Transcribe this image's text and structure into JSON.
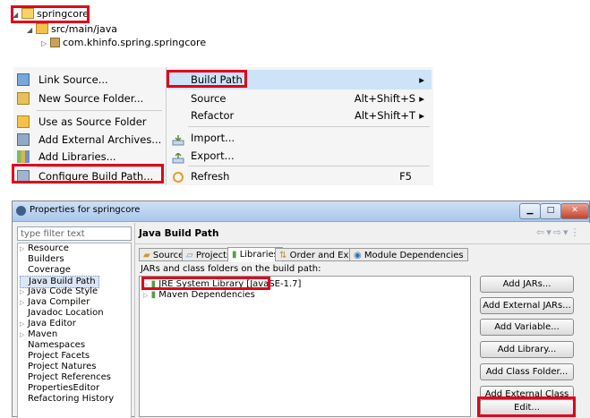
{
  "tree": {
    "project": "springcore",
    "folder": "src/main/java",
    "package": "com.khinfo.spring.springcore"
  },
  "menu": {
    "left_items": [
      {
        "label": "Link Source...",
        "icon": "link-source-icon"
      },
      {
        "label": "New Source Folder...",
        "icon": "new-source-folder-icon"
      },
      {
        "label": "Use as Source Folder",
        "icon": "source-folder-icon"
      },
      {
        "label": "Add External Archives...",
        "icon": "jar-icon"
      },
      {
        "label": "Add Libraries...",
        "icon": "library-icon"
      },
      {
        "label": "Configure Build Path...",
        "icon": "configure-build-path-icon"
      }
    ],
    "right_items": [
      {
        "label": "Build Path",
        "shortcut": "",
        "arrow": "▸"
      },
      {
        "label": "Source",
        "shortcut": "Alt+Shift+S",
        "arrow": "▸"
      },
      {
        "label": "Refactor",
        "shortcut": "Alt+Shift+T",
        "arrow": "▸"
      },
      {
        "label": "Import...",
        "shortcut": "",
        "arrow": ""
      },
      {
        "label": "Export...",
        "shortcut": "",
        "arrow": ""
      },
      {
        "label": "Refresh",
        "shortcut": "F5",
        "arrow": ""
      }
    ]
  },
  "dialog": {
    "title": "Properties for springcore",
    "filter_placeholder": "type filter text",
    "nav_items": [
      {
        "label": "Resource",
        "expandable": true
      },
      {
        "label": "Builders",
        "expandable": false
      },
      {
        "label": "Coverage",
        "expandable": false
      },
      {
        "label": "Java Build Path",
        "expandable": false,
        "selected": true
      },
      {
        "label": "Java Code Style",
        "expandable": true
      },
      {
        "label": "Java Compiler",
        "expandable": true
      },
      {
        "label": "Javadoc Location",
        "expandable": false
      },
      {
        "label": "Java Editor",
        "expandable": true
      },
      {
        "label": "Maven",
        "expandable": true
      },
      {
        "label": "Namespaces",
        "expandable": false
      },
      {
        "label": "Project Facets",
        "expandable": false
      },
      {
        "label": "Project Natures",
        "expandable": false
      },
      {
        "label": "Project References",
        "expandable": false
      },
      {
        "label": "PropertiesEditor",
        "expandable": false
      },
      {
        "label": "Refactoring History",
        "expandable": false
      }
    ],
    "page_title": "Java Build Path",
    "tabs": [
      {
        "label": "Source",
        "icon": "source-tab-icon"
      },
      {
        "label": "Projects",
        "icon": "projects-tab-icon"
      },
      {
        "label": "Libraries",
        "icon": "libraries-tab-icon",
        "active": true
      },
      {
        "label": "Order and Export",
        "icon": "order-export-tab-icon"
      },
      {
        "label": "Module Dependencies",
        "icon": "module-dependencies-tab-icon"
      }
    ],
    "list_caption": "JARs and class folders on the build path:",
    "libraries": [
      {
        "label": "JRE System Library [JavaSE-1.7]"
      },
      {
        "label": "Maven Dependencies"
      }
    ],
    "buttons": [
      "Add JARs...",
      "Add External JARs...",
      "Add Variable...",
      "Add Library...",
      "Add Class Folder...",
      "Add External Class Folder...",
      "Edit..."
    ]
  },
  "colors": {
    "highlight_box": "#e0001b",
    "menu_selection": "#cde3f7",
    "selection": "#3399ff"
  }
}
